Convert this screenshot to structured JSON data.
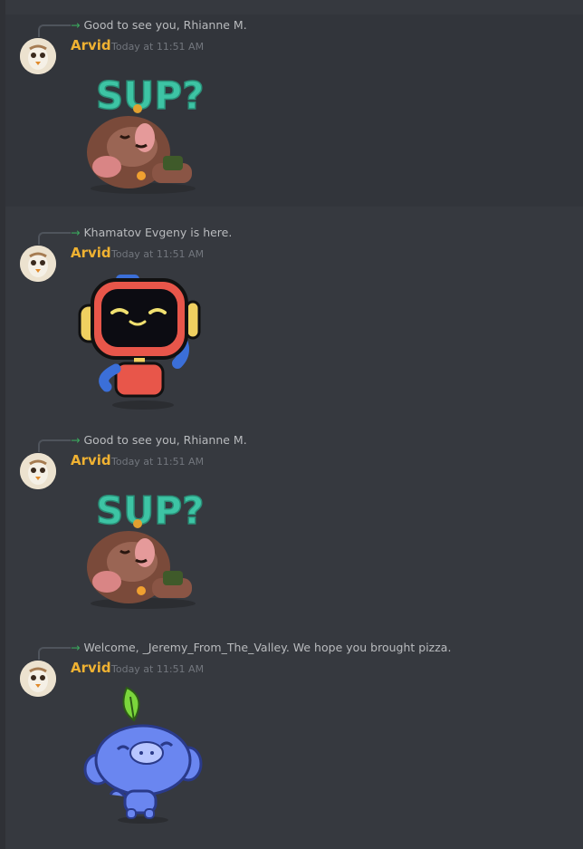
{
  "messages": [
    {
      "reply_text": "Good to see you, Rhianne M.",
      "author": "Arvid",
      "timestamp": "Today at 11:51 AM",
      "sticker_icon": "sup-sloth-sticker"
    },
    {
      "reply_text": "Khamatov Evgeny is here.",
      "author": "Arvid",
      "timestamp": "Today at 11:51 AM",
      "sticker_icon": "robot-waving-sticker"
    },
    {
      "reply_text": "Good to see you, Rhianne M.",
      "author": "Arvid",
      "timestamp": "Today at 11:51 AM",
      "sticker_icon": "sup-sloth-sticker"
    },
    {
      "reply_text": "Welcome, _Jeremy_From_The_Valley. We hope you brought pizza.",
      "author": "Arvid",
      "timestamp": "Today at 11:51 AM",
      "sticker_icon": "wumpus-sprout-sticker"
    }
  ],
  "colors": {
    "background": "#36393f",
    "author": "#f0b232",
    "arrow": "#3ba55d",
    "timestamp": "#72767d"
  }
}
